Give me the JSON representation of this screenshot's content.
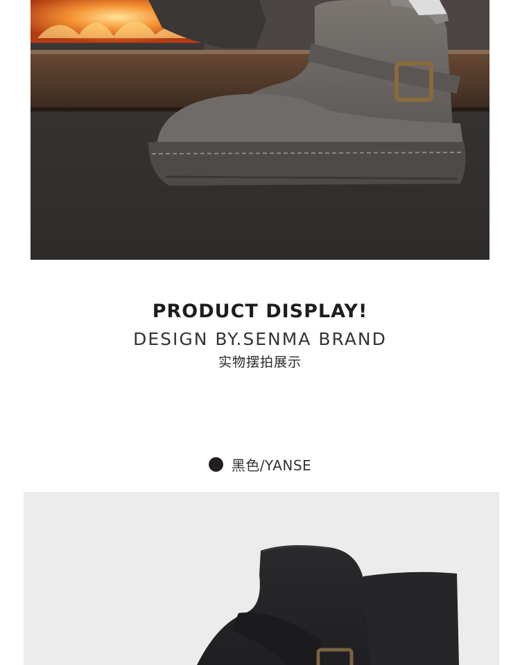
{
  "display_heading": {
    "title": "PRODUCT DISPLAY!",
    "subtitle": "DESIGN BY.SENMA BRAND",
    "caption": "实物摆拍展示"
  },
  "color_option": {
    "label": "黑色/YANSE",
    "swatch_color": "#231f20"
  },
  "colors": {
    "hero_boot": "#6b6764",
    "product_boot": "#2b2b2d",
    "panel_background": "#ececec"
  },
  "images": {
    "hero": "grey-suede-boot-photo",
    "product": "black-suede-boot-photo"
  }
}
